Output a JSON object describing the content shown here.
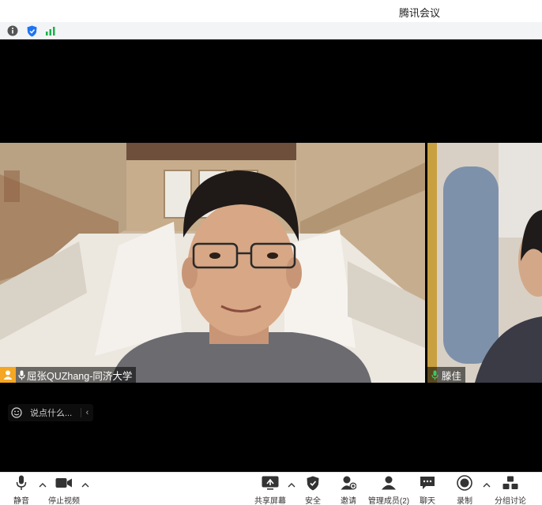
{
  "window": {
    "title": "腾讯会议"
  },
  "infobar": {
    "icons": [
      "info-icon",
      "shield-icon",
      "signal-bars-icon"
    ]
  },
  "participants": {
    "main": {
      "name": "屈张QUZhang-同济大学",
      "mic_state": "on",
      "icon": "person-avatar-icon"
    },
    "side": {
      "name": "滕佳",
      "mic_state": "on"
    }
  },
  "chat": {
    "placeholder": "说点什么...",
    "collapse_glyph": "‹"
  },
  "toolbar": {
    "mute": "静音",
    "stop_video": "停止视频",
    "share_screen": "共享屏幕",
    "security": "安全",
    "invite": "邀请",
    "manage_members": "管理成员(2)",
    "chat": "聊天",
    "record": "录制",
    "breakout": "分组讨论"
  },
  "colors": {
    "avatar_badge": "#f5a623",
    "mic_on": "#3cc46a",
    "signal": "#19b04a",
    "shield": "#1e74f2"
  }
}
